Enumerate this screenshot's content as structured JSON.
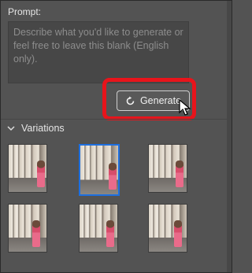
{
  "prompt": {
    "label": "Prompt:",
    "placeholder": "Describe what you'd like to generate or\nfeel free to leave this blank (English\nonly)."
  },
  "generate_button": {
    "label": "Generate",
    "icon": "refresh-icon"
  },
  "highlight_color": "#e8141b",
  "variations": {
    "title": "Variations",
    "expanded": true,
    "thumbnails": [
      {
        "selected": false
      },
      {
        "selected": true
      },
      {
        "selected": false
      },
      {
        "selected": false
      },
      {
        "selected": false
      },
      {
        "selected": false
      }
    ],
    "selected_color": "#1d6fe0"
  }
}
